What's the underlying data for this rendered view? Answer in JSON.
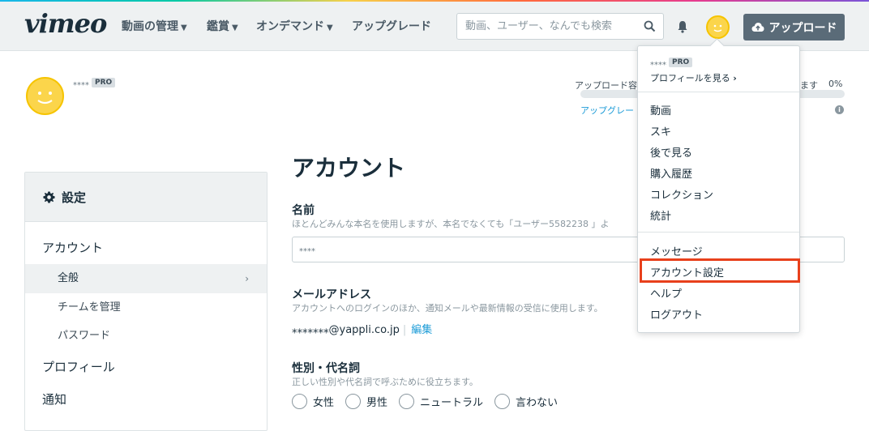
{
  "header": {
    "logo": "vimeo",
    "nav": [
      {
        "label": "動画の管理",
        "dropdown": true
      },
      {
        "label": "鑑賞",
        "dropdown": true
      },
      {
        "label": "オンデマンド",
        "dropdown": true
      },
      {
        "label": "アップグレード",
        "dropdown": false
      }
    ],
    "search_placeholder": "動画、ユーザー、なんでも検索",
    "upload_label": "アップロード"
  },
  "profile": {
    "username": "⁎⁎⁎⁎",
    "badge": "PRO",
    "upload_quota_label": "アップロード容",
    "upload_quota_suffix": "ます",
    "upload_quota_percent": "0%",
    "upload_quota_value": 0,
    "upgrade_link": "アップグレー"
  },
  "sidebar": {
    "header": "設定",
    "items": [
      {
        "label": "アカウント",
        "level": 1
      },
      {
        "label": "全般",
        "level": 2,
        "active": true
      },
      {
        "label": "チームを管理",
        "level": 2
      },
      {
        "label": "パスワード",
        "level": 2
      },
      {
        "label": "プロフィール",
        "level": 1
      },
      {
        "label": "通知",
        "level": 1
      }
    ]
  },
  "main": {
    "title": "アカウント",
    "name_label": "名前",
    "name_help": "ほとんどみんな本名を使用しますが、本名でなくても「ユーザー5582238 」よ",
    "name_value": "⁎⁎⁎⁎",
    "email_label": "メールアドレス",
    "email_help": "アカウントへのログインのほか、通知メールや最新情報の受信に使用します。",
    "email_value": "⁎⁎⁎⁎⁎⁎⁎@yappli.co.jp",
    "email_edit": "編集",
    "gender_label": "性別・代名詞",
    "gender_help": "正しい性別や代名詞で呼ぶために役立ちます。",
    "gender_options": [
      "女性",
      "男性",
      "ニュートラル",
      "言わない"
    ]
  },
  "dropdown": {
    "username": "⁎⁎⁎⁎",
    "badge": "PRO",
    "profile_link": "プロフィールを見る",
    "group1": [
      "動画",
      "スキ",
      "後で見る",
      "購入履歴",
      "コレクション",
      "統計"
    ],
    "group2": [
      "メッセージ",
      "アカウント設定",
      "ヘルプ",
      "ログアウト"
    ],
    "highlight_color": "#e8401c"
  }
}
